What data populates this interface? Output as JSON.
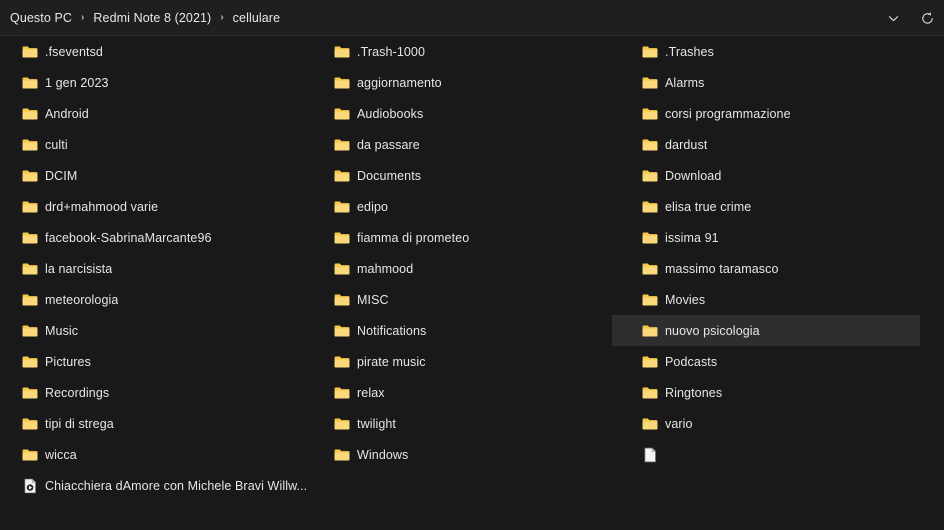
{
  "window": {
    "background_color": "#191919",
    "header_color": "#1f1f1f",
    "selection_color": "#2e2e2e",
    "folder_color": "#f7c94b",
    "text_color": "#e6e6e6"
  },
  "header": {
    "breadcrumb": [
      {
        "label": "Questo PC"
      },
      {
        "label": "Redmi Note 8 (2021)"
      },
      {
        "label": "cellulare"
      }
    ],
    "separator": "›",
    "actions": [
      {
        "name": "chevron-down-icon",
        "label": ""
      },
      {
        "name": "refresh-icon",
        "label": ""
      }
    ]
  },
  "columns": [
    {
      "index": 1,
      "items": [
        {
          "name": ".fseventsd",
          "icon": "folder-icon",
          "selected": false
        },
        {
          "name": "1 gen 2023",
          "icon": "folder-icon",
          "selected": false
        },
        {
          "name": "Android",
          "icon": "folder-icon",
          "selected": false
        },
        {
          "name": "culti",
          "icon": "folder-icon",
          "selected": false
        },
        {
          "name": "DCIM",
          "icon": "folder-icon",
          "selected": false
        },
        {
          "name": "drd+mahmood varie",
          "icon": "folder-icon",
          "selected": false
        },
        {
          "name": "facebook-SabrinaMarcante96",
          "icon": "folder-icon",
          "selected": false
        },
        {
          "name": "la narcisista",
          "icon": "folder-icon",
          "selected": false
        },
        {
          "name": "meteorologia",
          "icon": "folder-icon",
          "selected": false
        },
        {
          "name": "Music",
          "icon": "folder-icon",
          "selected": false
        },
        {
          "name": "Pictures",
          "icon": "folder-icon",
          "selected": false
        },
        {
          "name": "Recordings",
          "icon": "folder-icon",
          "selected": false
        },
        {
          "name": "tipi di strega",
          "icon": "folder-icon",
          "selected": false
        },
        {
          "name": "wicca",
          "icon": "folder-icon",
          "selected": false
        },
        {
          "name": "Chiacchiera dAmore con Michele Bravi  Willw...",
          "icon": "video-file-icon",
          "selected": false
        }
      ]
    },
    {
      "index": 2,
      "items": [
        {
          "name": ".Trash-1000",
          "icon": "folder-icon",
          "selected": false
        },
        {
          "name": "aggiornamento",
          "icon": "folder-icon",
          "selected": false
        },
        {
          "name": "Audiobooks",
          "icon": "folder-icon",
          "selected": false
        },
        {
          "name": "da passare",
          "icon": "folder-icon",
          "selected": false
        },
        {
          "name": "Documents",
          "icon": "folder-icon",
          "selected": false
        },
        {
          "name": "edipo",
          "icon": "folder-icon",
          "selected": false
        },
        {
          "name": "fiamma di prometeo",
          "icon": "folder-icon",
          "selected": false
        },
        {
          "name": "mahmood",
          "icon": "folder-icon",
          "selected": false
        },
        {
          "name": "MISC",
          "icon": "folder-icon",
          "selected": false
        },
        {
          "name": "Notifications",
          "icon": "folder-icon",
          "selected": false
        },
        {
          "name": "pirate music",
          "icon": "folder-icon",
          "selected": false
        },
        {
          "name": "relax",
          "icon": "folder-icon",
          "selected": false
        },
        {
          "name": "twilight",
          "icon": "folder-icon",
          "selected": false
        },
        {
          "name": "Windows",
          "icon": "folder-icon",
          "selected": false
        }
      ]
    },
    {
      "index": 3,
      "items": [
        {
          "name": ".Trashes",
          "icon": "folder-icon",
          "selected": false
        },
        {
          "name": "Alarms",
          "icon": "folder-icon",
          "selected": false
        },
        {
          "name": "corsi programmazione",
          "icon": "folder-icon",
          "selected": false
        },
        {
          "name": "dardust",
          "icon": "folder-icon",
          "selected": false
        },
        {
          "name": "Download",
          "icon": "folder-icon",
          "selected": false
        },
        {
          "name": "elisa true crime",
          "icon": "folder-icon",
          "selected": false
        },
        {
          "name": "issima 91",
          "icon": "folder-icon",
          "selected": false
        },
        {
          "name": "massimo taramasco",
          "icon": "folder-icon",
          "selected": false
        },
        {
          "name": "Movies",
          "icon": "folder-icon",
          "selected": false
        },
        {
          "name": "nuovo psicologia",
          "icon": "folder-icon",
          "selected": true
        },
        {
          "name": "Podcasts",
          "icon": "folder-icon",
          "selected": false
        },
        {
          "name": "Ringtones",
          "icon": "folder-icon",
          "selected": false
        },
        {
          "name": "vario",
          "icon": "folder-icon",
          "selected": false
        },
        {
          "name": "",
          "icon": "blank-file-icon",
          "selected": false
        }
      ]
    }
  ]
}
